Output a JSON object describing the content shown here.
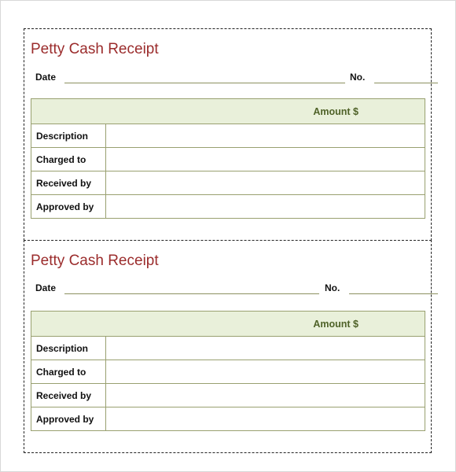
{
  "receipts": [
    {
      "title": "Petty Cash Receipt",
      "date_label": "Date",
      "no_label": "No.",
      "amount_header": "Amount $",
      "rows": [
        {
          "label": "Description",
          "value": ""
        },
        {
          "label": "Charged to",
          "value": ""
        },
        {
          "label": "Received by",
          "value": ""
        },
        {
          "label": "Approved by",
          "value": ""
        }
      ]
    },
    {
      "title": "Petty Cash Receipt",
      "date_label": "Date",
      "no_label": "No.",
      "amount_header": "Amount $",
      "rows": [
        {
          "label": "Description",
          "value": ""
        },
        {
          "label": "Charged to",
          "value": ""
        },
        {
          "label": "Received by",
          "value": ""
        },
        {
          "label": "Approved by",
          "value": ""
        }
      ]
    }
  ],
  "colors": {
    "title": "#9b2c2c",
    "header_bg": "#e9f0da",
    "header_text": "#4f6228",
    "border": "#99a070"
  }
}
